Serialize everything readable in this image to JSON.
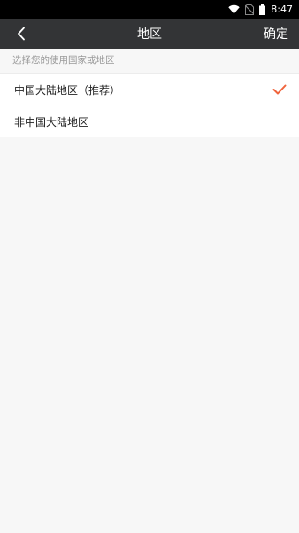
{
  "status_bar": {
    "time": "8:47",
    "icons": [
      "wifi-icon",
      "no-sim-icon",
      "battery-icon"
    ]
  },
  "app_bar": {
    "back_icon": "chevron-left-icon",
    "title": "地区",
    "confirm_label": "确定"
  },
  "hint": "选择您的使用国家或地区",
  "regions": [
    {
      "label": "中国大陆地区（推荐）",
      "selected": true
    },
    {
      "label": "非中国大陆地区",
      "selected": false
    }
  ],
  "colors": {
    "app_bar_bg": "#333436",
    "accent_check": "#f0643c",
    "page_bg": "#f7f7f7"
  }
}
